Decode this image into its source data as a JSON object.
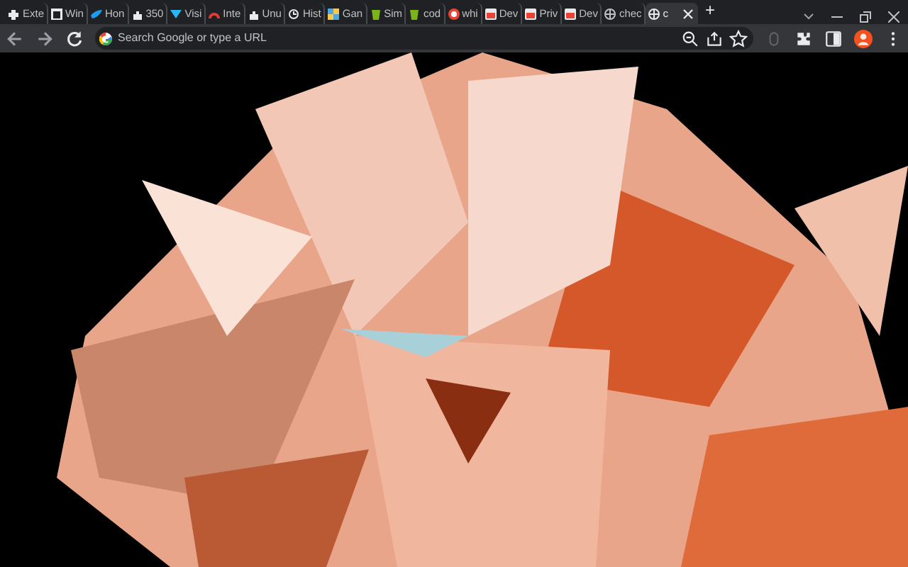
{
  "tabs": [
    {
      "title": "Exte",
      "selected": false
    },
    {
      "title": "Win",
      "selected": false
    },
    {
      "title": "Hon",
      "selected": false
    },
    {
      "title": "350",
      "selected": false
    },
    {
      "title": "Visi",
      "selected": false
    },
    {
      "title": "Inte",
      "selected": false
    },
    {
      "title": "Unu",
      "selected": false
    },
    {
      "title": "Hist",
      "selected": false
    },
    {
      "title": "Gan",
      "selected": false
    },
    {
      "title": "Sim",
      "selected": false
    },
    {
      "title": "cod",
      "selected": false
    },
    {
      "title": "whi",
      "selected": false
    },
    {
      "title": "Dev",
      "selected": false
    },
    {
      "title": "Priv",
      "selected": false
    },
    {
      "title": "Dev",
      "selected": false
    },
    {
      "title": "chec",
      "selected": false
    },
    {
      "title": "c",
      "selected": true
    }
  ],
  "new_tab": "+",
  "omnibox": {
    "placeholder": "Search Google or type a URL"
  }
}
